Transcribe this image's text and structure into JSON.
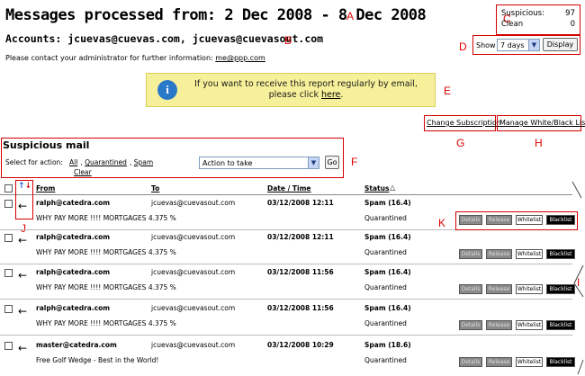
{
  "header": {
    "title": "Messages processed from: 2 Dec 2008 - 8 Dec 2008",
    "accounts": "Accounts: jcuevas@cuevas.com, jcuevas@cuevasout.com",
    "contact_text": "Please contact your administrator for further information:",
    "contact_email": "me@ppp.com"
  },
  "counts": {
    "suspicious_label": "Suspicious:",
    "suspicious_value": "97",
    "clean_label": "Clean",
    "clean_value": "0"
  },
  "show": {
    "label": "Show",
    "selected": "7 days",
    "display_button": "Display"
  },
  "banner": {
    "icon": "i",
    "text": "If you want to receive this report regularly by email, please click",
    "link": "here"
  },
  "links": {
    "change_subscription": "Change Subscription",
    "manage_lists": "Manage White/Black Lists"
  },
  "suspicious": {
    "title": "Suspicious mail",
    "select_label": "Select for action:",
    "all": "All",
    "quarantined": "Quarantined",
    "spam": "Spam",
    "clear": "Clear",
    "action_selected": "Action to take",
    "go": "Go"
  },
  "table": {
    "headers": {
      "from": "From",
      "to": "To",
      "date": "Date / Time",
      "status": "Status"
    },
    "rows": [
      {
        "from": "ralph@catedra.com",
        "to": "jcuevas@cuevasout.com",
        "date": "03/12/2008 12:11",
        "status": "Spam (16.4)",
        "subject": "WHY PAY MORE !!!! MORTGAGES 4.375 %",
        "state": "Quarantined"
      },
      {
        "from": "ralph@catedra.com",
        "to": "jcuevas@cuevasout.com",
        "date": "03/12/2008 12:11",
        "status": "Spam (16.4)",
        "subject": "WHY PAY MORE !!!! MORTGAGES 4.375 %",
        "state": "Quarantined"
      },
      {
        "from": "ralph@catedra.com",
        "to": "jcuevas@cuevasout.com",
        "date": "03/12/2008 11:56",
        "status": "Spam (16.4)",
        "subject": "WHY PAY MORE !!!! MORTGAGES 4.375 %",
        "state": "Quarantined"
      },
      {
        "from": "ralph@catedra.com",
        "to": "jcuevas@cuevasout.com",
        "date": "03/12/2008 11:56",
        "status": "Spam (16.4)",
        "subject": "WHY PAY MORE !!!! MORTGAGES 4.375 %",
        "state": "Quarantined"
      },
      {
        "from": "master@catedra.com",
        "to": "jcuevas@cuevasout.com",
        "date": "03/12/2008 10:29",
        "status": "Spam (18.6)",
        "subject": "Free Golf Wedge - Best in the World!",
        "state": "Quarantined"
      }
    ],
    "actions": {
      "details": "Details",
      "release": "Release",
      "whitelist": "Whitelist",
      "blacklist": "Blacklist"
    }
  },
  "callouts": {
    "a": "A",
    "b": "B",
    "c": "C",
    "d": "D",
    "e": "E",
    "f": "F",
    "g": "G",
    "h": "H",
    "i": "I",
    "j": "J",
    "k": "K"
  },
  "colors": {
    "callout": "#e00000",
    "banner": "#f7f09a",
    "info_icon": "#2a79c9",
    "sort_up": "#1a5fd0",
    "sort_down": "#d01a1a"
  }
}
